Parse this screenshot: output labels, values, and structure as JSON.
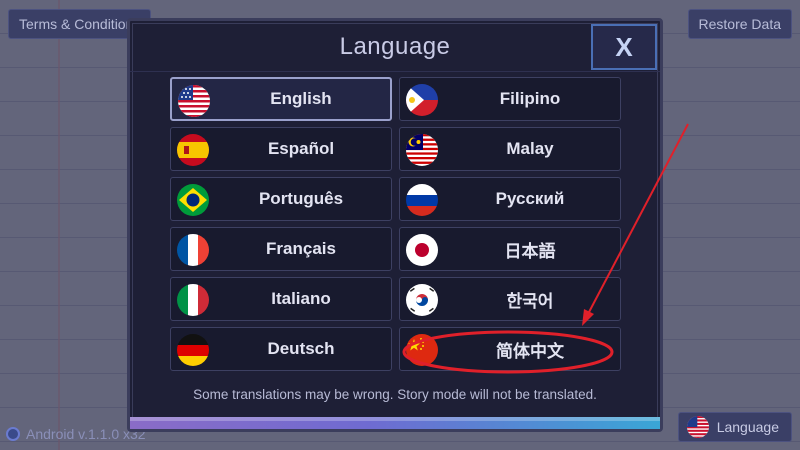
{
  "top_bar": {
    "terms_label": "Terms & Conditions",
    "restore_label": "Restore Data"
  },
  "footer": {
    "version_text": "Android v.1.1.0 x32",
    "language_button_label": "Language"
  },
  "modal": {
    "title": "Language",
    "close_label": "X",
    "note": "Some translations may be wrong. Story mode will not be translated.",
    "languages": [
      {
        "label": "English",
        "flag": "us-flag-icon",
        "selected": true
      },
      {
        "label": "Filipino",
        "flag": "philippines-flag-icon"
      },
      {
        "label": "Español",
        "flag": "spain-flag-icon"
      },
      {
        "label": "Malay",
        "flag": "malaysia-flag-icon"
      },
      {
        "label": "Português",
        "flag": "brazil-flag-icon"
      },
      {
        "label": "Русский",
        "flag": "russia-flag-icon"
      },
      {
        "label": "Français",
        "flag": "france-flag-icon"
      },
      {
        "label": "日本語",
        "flag": "japan-flag-icon"
      },
      {
        "label": "Italiano",
        "flag": "italy-flag-icon"
      },
      {
        "label": "한국어",
        "flag": "korea-flag-icon"
      },
      {
        "label": "Deutsch",
        "flag": "germany-flag-icon"
      },
      {
        "label": "简体中文",
        "flag": "china-flag-icon",
        "highlighted": true
      }
    ]
  },
  "colors": {
    "annotation": "#e0202a",
    "selected_border": "#9aa0cc",
    "close_border": "#4a6fb5"
  }
}
